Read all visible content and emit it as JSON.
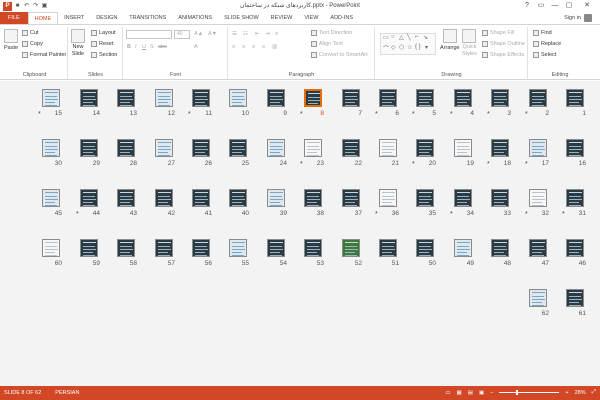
{
  "window": {
    "title": "کاربردهای شبکه در ساختمان.pptx - PowerPoint",
    "controls": [
      "?",
      "▭",
      "—",
      "▢",
      "✕"
    ]
  },
  "tabs": [
    {
      "label": "FILE",
      "kind": "file"
    },
    {
      "label": "HOME",
      "kind": "active"
    },
    {
      "label": "INSERT"
    },
    {
      "label": "DESIGN"
    },
    {
      "label": "TRANSITIONS"
    },
    {
      "label": "ANIMATIONS"
    },
    {
      "label": "SLIDE SHOW"
    },
    {
      "label": "REVIEW"
    },
    {
      "label": "VIEW"
    },
    {
      "label": "ADD-INS"
    }
  ],
  "signin": "Sign in",
  "ribbon": {
    "clipboard": {
      "label": "Clipboard",
      "paste": "Paste",
      "cut": "Cut",
      "copy": "Copy",
      "format_painter": "Format Painter"
    },
    "slides": {
      "label": "Slides",
      "new_slide": "New",
      "new_slide2": "Slide",
      "layout": "Layout",
      "reset": "Reset",
      "section": "Section"
    },
    "font": {
      "label": "Font",
      "size": "40"
    },
    "paragraph": {
      "label": "Paragraph",
      "text_direction": "Text Direction",
      "align_text": "Align Text",
      "convert": "Convert to SmartArt"
    },
    "drawing": {
      "label": "Drawing",
      "arrange": "Arrange",
      "quick_styles": "Quick",
      "quick_styles2": "Styles",
      "shape_fill": "Shape Fill",
      "shape_outline": "Shape Outline",
      "shape_effects": "Shape Effects"
    },
    "editing": {
      "label": "Editing",
      "find": "Find",
      "replace": "Replace",
      "select": "Select"
    }
  },
  "slides": [
    {
      "n": "1",
      "star": false,
      "kind": "dark"
    },
    {
      "n": "2",
      "star": true,
      "kind": "dark"
    },
    {
      "n": "3",
      "star": true,
      "kind": "dark"
    },
    {
      "n": "4",
      "star": true,
      "kind": "dark"
    },
    {
      "n": "5",
      "star": true,
      "kind": "dark"
    },
    {
      "n": "6",
      "star": true,
      "kind": "dark"
    },
    {
      "n": "7",
      "star": false,
      "kind": "dark"
    },
    {
      "n": "8",
      "star": true,
      "kind": "dark",
      "selected": true
    },
    {
      "n": "9",
      "star": false,
      "kind": "dark"
    },
    {
      "n": "10",
      "star": false,
      "kind": "pic"
    },
    {
      "n": "11",
      "star": true,
      "kind": "dark"
    },
    {
      "n": "12",
      "star": false,
      "kind": "pic"
    },
    {
      "n": "13",
      "star": false,
      "kind": "dark"
    },
    {
      "n": "14",
      "star": false,
      "kind": "dark"
    },
    {
      "n": "15",
      "star": true,
      "kind": "pic"
    },
    {
      "n": "16",
      "star": false,
      "kind": "dark"
    },
    {
      "n": "17",
      "star": true,
      "kind": "pic"
    },
    {
      "n": "18",
      "star": true,
      "kind": "dark"
    },
    {
      "n": "19",
      "star": false,
      "kind": "white"
    },
    {
      "n": "20",
      "star": true,
      "kind": "dark"
    },
    {
      "n": "21",
      "star": false,
      "kind": "white"
    },
    {
      "n": "22",
      "star": false,
      "kind": "dark"
    },
    {
      "n": "23",
      "star": true,
      "kind": "white"
    },
    {
      "n": "24",
      "star": false,
      "kind": "pic"
    },
    {
      "n": "25",
      "star": false,
      "kind": "dark"
    },
    {
      "n": "26",
      "star": false,
      "kind": "dark"
    },
    {
      "n": "27",
      "star": false,
      "kind": "pic"
    },
    {
      "n": "28",
      "star": false,
      "kind": "dark"
    },
    {
      "n": "29",
      "star": false,
      "kind": "dark"
    },
    {
      "n": "30",
      "star": false,
      "kind": "pic"
    },
    {
      "n": "31",
      "star": true,
      "kind": "dark"
    },
    {
      "n": "32",
      "star": true,
      "kind": "white"
    },
    {
      "n": "33",
      "star": false,
      "kind": "dark"
    },
    {
      "n": "34",
      "star": true,
      "kind": "dark"
    },
    {
      "n": "35",
      "star": false,
      "kind": "dark"
    },
    {
      "n": "36",
      "star": true,
      "kind": "white"
    },
    {
      "n": "37",
      "star": false,
      "kind": "dark"
    },
    {
      "n": "38",
      "star": false,
      "kind": "dark"
    },
    {
      "n": "39",
      "star": false,
      "kind": "pic"
    },
    {
      "n": "40",
      "star": false,
      "kind": "dark"
    },
    {
      "n": "41",
      "star": false,
      "kind": "dark"
    },
    {
      "n": "42",
      "star": false,
      "kind": "dark"
    },
    {
      "n": "43",
      "star": false,
      "kind": "dark"
    },
    {
      "n": "44",
      "star": true,
      "kind": "dark"
    },
    {
      "n": "45",
      "star": false,
      "kind": "pic"
    },
    {
      "n": "46",
      "star": false,
      "kind": "dark"
    },
    {
      "n": "47",
      "star": false,
      "kind": "dark"
    },
    {
      "n": "48",
      "star": false,
      "kind": "dark"
    },
    {
      "n": "49",
      "star": false,
      "kind": "pic"
    },
    {
      "n": "50",
      "star": false,
      "kind": "dark"
    },
    {
      "n": "51",
      "star": false,
      "kind": "dark"
    },
    {
      "n": "52",
      "star": false,
      "kind": "green"
    },
    {
      "n": "53",
      "star": false,
      "kind": "dark"
    },
    {
      "n": "54",
      "star": false,
      "kind": "dark"
    },
    {
      "n": "55",
      "star": false,
      "kind": "pic"
    },
    {
      "n": "56",
      "star": false,
      "kind": "dark"
    },
    {
      "n": "57",
      "star": false,
      "kind": "dark"
    },
    {
      "n": "58",
      "star": false,
      "kind": "dark"
    },
    {
      "n": "59",
      "star": false,
      "kind": "dark"
    },
    {
      "n": "60",
      "star": false,
      "kind": "white"
    },
    {
      "n": "61",
      "star": false,
      "kind": "dark"
    },
    {
      "n": "62",
      "star": false,
      "kind": "pic"
    }
  ],
  "status": {
    "slide_of": "SLIDE 8 OF 62",
    "language": "PERSIAN",
    "zoom": "28%",
    "zoom_fraction": 0.28
  },
  "colors": {
    "accent": "#d24726",
    "selection": "#e46c0a"
  }
}
